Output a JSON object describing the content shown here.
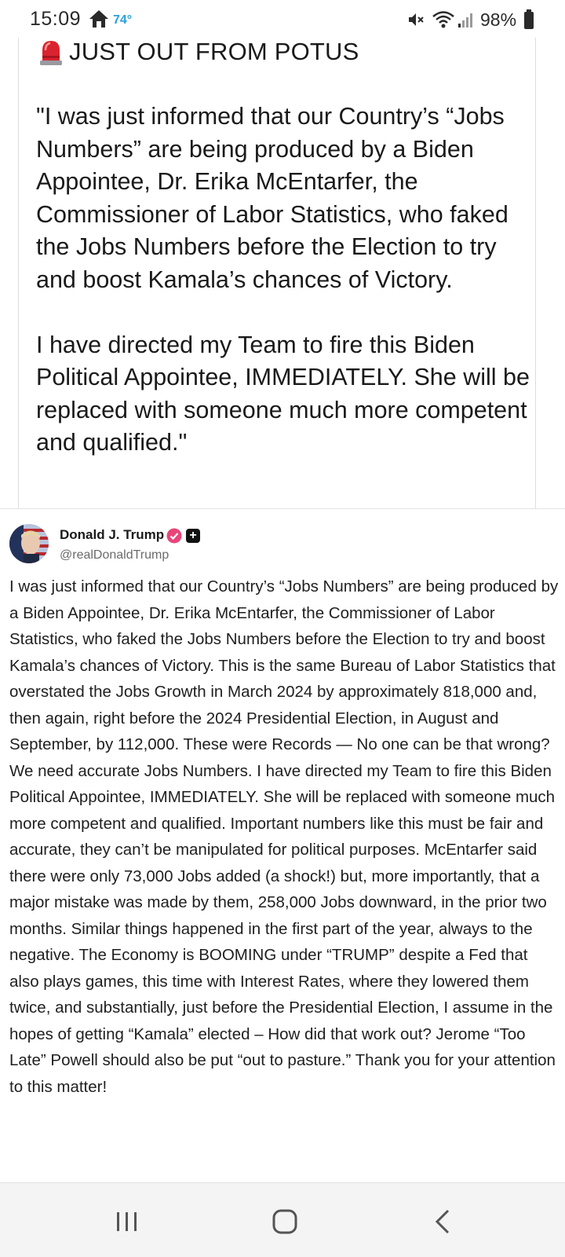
{
  "status_bar": {
    "time": "15:09",
    "temperature": "74°",
    "battery": "98%",
    "icons": [
      "home-icon",
      "mute-icon",
      "wifi-icon",
      "signal-icon",
      "battery-icon"
    ]
  },
  "quote_card": {
    "heading": "JUST OUT FROM POTUS",
    "heading_icon": "siren-icon",
    "paragraphs": [
      "\"I was just informed that our Country’s “Jobs Numbers” are being produced by a Biden Appointee, Dr. Erika McEntarfer, the Commissioner of Labor Statistics, who faked the Jobs Numbers before the Election to try and boost Kamala’s chances of Victory.",
      "I have directed my Team to fire this Biden Political Appointee, IMMEDIATELY. She will be replaced with someone much more competent and qualified.\""
    ]
  },
  "post": {
    "author_name": "Donald J. Trump",
    "author_handle": "@realDonaldTrump",
    "colors": {
      "verified": "#e8457a",
      "temp": "#2aa0d8"
    },
    "body": "I was just informed that our Country’s “Jobs Numbers” are being produced by a Biden Appointee, Dr. Erika McEntarfer, the Commissioner of Labor Statistics, who faked the Jobs Numbers before the Election to try and boost Kamala’s chances of Victory. This is the same Bureau of Labor Statistics that overstated the Jobs Growth in March 2024 by approximately 818,000 and, then again, right before the 2024 Presidential Election, in August and September, by 112,000. These were Records — No one can be that wrong? We need accurate Jobs Numbers. I have directed my Team to fire this Biden Political Appointee, IMMEDIATELY. She will be replaced with someone much more competent and qualified. Important numbers like this must be fair and accurate, they can’t be manipulated for political purposes. McEntarfer said there were only 73,000 Jobs added (a shock!) but, more importantly, that a major mistake was made by them, 258,000 Jobs downward, in the prior two months. Similar things happened in the first part of the year, always to the negative. The Economy is BOOMING under “TRUMP” despite a Fed that also plays games, this time with Interest Rates, where they lowered them twice, and substantially, just before the Presidential Election, I assume in the hopes of getting “Kamala” elected – How did that work out? Jerome “Too Late” Powell should also be put “out to pasture.” Thank you for your attention to this matter!"
  },
  "nav_bar": {
    "icons": [
      "recent-apps-icon",
      "home-button-icon",
      "back-icon"
    ]
  }
}
